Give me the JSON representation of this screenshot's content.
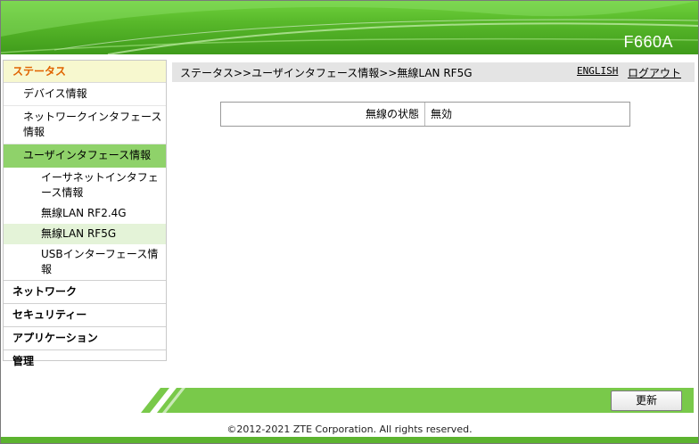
{
  "header": {
    "model": "F660A"
  },
  "sidebar": {
    "top": "ステータス",
    "items": [
      {
        "label": "デバイス情報"
      },
      {
        "label": "ネットワークインタフェース情報"
      },
      {
        "label": "ユーザインタフェース情報"
      }
    ],
    "subitems": [
      {
        "label": "イーサネットインタフェース情報"
      },
      {
        "label": "無線LAN RF2.4G"
      },
      {
        "label": "無線LAN RF5G"
      },
      {
        "label": "USBインターフェース情報"
      }
    ],
    "sections": [
      {
        "label": "ネットワーク"
      },
      {
        "label": "セキュリティー"
      },
      {
        "label": "アプリケーション"
      },
      {
        "label": "管理"
      }
    ]
  },
  "breadcrumb": "ステータス>>ユーザインタフェース情報>>無線LAN RF5G",
  "links": {
    "english": "ENGLISH",
    "logout": "ログアウト"
  },
  "status_table": {
    "label": "無線の状態",
    "value": "無効"
  },
  "footer": {
    "refresh_label": "更新",
    "copyright": "©2012-2021 ZTE Corporation. All rights reserved."
  },
  "colors": {
    "brand_green": "#5cb32f",
    "active_orange": "#e06400",
    "active_bg": "#8fd26a"
  }
}
